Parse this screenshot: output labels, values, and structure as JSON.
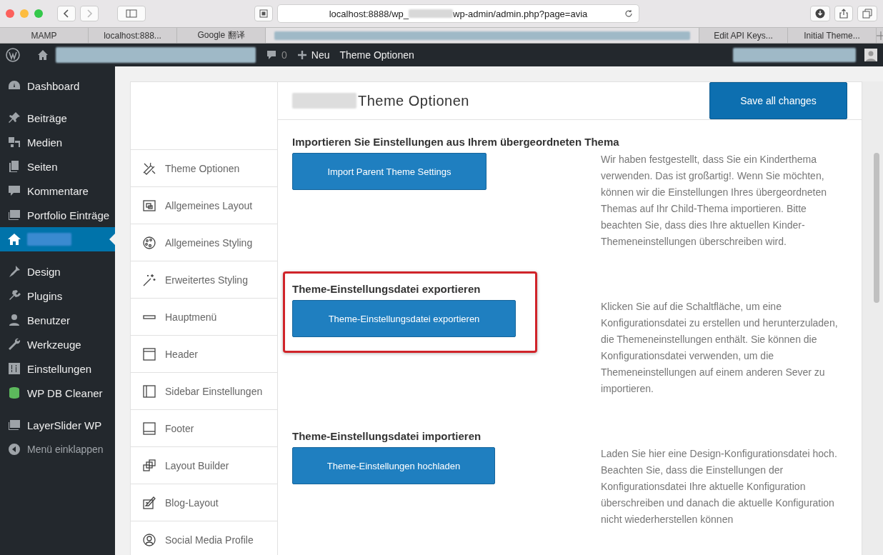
{
  "browser": {
    "url_start": "localhost:8888/wp_",
    "url_end": "wp-admin/admin.php?page=avia",
    "tabs": [
      {
        "label": "MAMP",
        "selected": false
      },
      {
        "label": "localhost:888...",
        "selected": false
      },
      {
        "label": "Google 翻译",
        "selected": false
      },
      {
        "selected": true
      },
      {
        "label": "Edit API Keys...",
        "selected": false
      },
      {
        "label": "Initial Theme...",
        "selected": false
      }
    ]
  },
  "admin_bar": {
    "comments": "0",
    "new": "Neu",
    "page": "Theme Optionen"
  },
  "sidebar": {
    "groups": [
      [
        {
          "label": "Dashboard",
          "selected": false,
          "muted": false
        }
      ],
      [
        {
          "label": "Beiträge",
          "selected": false,
          "muted": false
        },
        {
          "label": "Medien",
          "selected": false,
          "muted": false
        },
        {
          "label": "Seiten",
          "selected": false,
          "muted": false
        },
        {
          "label": "Kommentare",
          "selected": false,
          "muted": false
        },
        {
          "label": "Portfolio Einträge",
          "selected": false,
          "muted": false
        },
        {
          "selected": true,
          "muted": false
        }
      ],
      [
        {
          "label": "Design",
          "selected": false,
          "muted": false
        },
        {
          "label": "Plugins",
          "selected": false,
          "muted": false
        },
        {
          "label": "Benutzer",
          "selected": false,
          "muted": false
        },
        {
          "label": "Werkzeuge",
          "selected": false,
          "muted": false
        },
        {
          "label": "Einstellungen",
          "selected": false,
          "muted": false
        },
        {
          "label": "WP DB Cleaner",
          "selected": false,
          "muted": false
        }
      ],
      [
        {
          "label": "LayerSlider WP",
          "selected": false,
          "muted": false
        },
        {
          "label": "Menü einklappen",
          "selected": false,
          "muted": true
        }
      ]
    ]
  },
  "page": {
    "title": "Theme Optionen",
    "save": "Save all changes"
  },
  "nav": [
    "Theme Optionen",
    "Allgemeines Layout",
    "Allgemeines Styling",
    "Erweitertes Styling",
    "Hauptmenü",
    "Header",
    "Sidebar Einstellungen",
    "Footer",
    "Layout Builder",
    "Blog-Layout",
    "Social Media Profile"
  ],
  "sections": [
    {
      "heading": "Importieren Sie Einstellungen aus Ihrem übergeordneten Thema",
      "button": "Import Parent Theme Settings",
      "highlighted": false,
      "text": "Wir haben festgestellt, dass Sie ein Kinderthema verwenden. Das ist großartig!. Wenn Sie möchten, können wir die Einstellungen Ihres übergeordneten Themas auf Ihr Child-Thema importieren. Bitte beachten Sie, dass dies Ihre aktuellen Kinder-Themeneinstellungen überschreiben wird."
    },
    {
      "heading": "Theme-Einstellungsdatei exportieren",
      "button": "Theme-Einstellungsdatei exportieren",
      "highlighted": true,
      "text": "Klicken Sie auf die Schaltfläche, um eine Konfigurationsdatei zu erstellen und herunterzuladen, die Themeneinstellungen enthält. Sie können die Konfigurationsdatei verwenden, um die Themeneinstellungen auf einem anderen Sever zu importieren."
    },
    {
      "heading": "Theme-Einstellungsdatei importieren",
      "button": "Theme-Einstellungen hochladen",
      "highlighted": false,
      "text": "Laden Sie hier eine Design-Konfigurationsdatei hoch. Beachten Sie, dass die Einstellungen der Konfigurationsdatei Ihre aktuelle Konfiguration überschreiben und danach die aktuelle Konfiguration nicht wiederherstellen können"
    }
  ]
}
